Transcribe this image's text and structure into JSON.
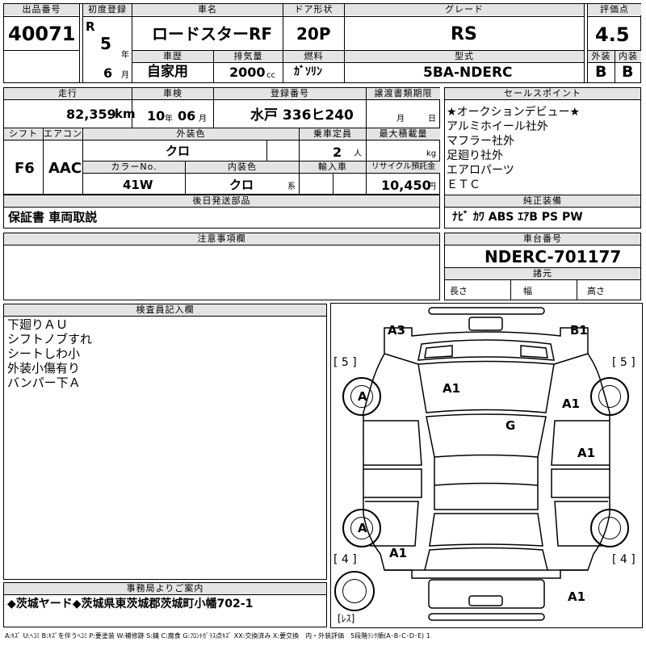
{
  "header": {
    "lot_no_label": "出品番号",
    "lot_no": "40071",
    "first_reg_label": "初度登録",
    "era": "R",
    "year": "5",
    "year_unit": "年",
    "month": "6",
    "month_unit": "月",
    "car_name_label": "車名",
    "car_name": "ロードスターRF",
    "door_label": "ドア形状",
    "door": "20P",
    "grade_label": "グレード",
    "grade": "RS",
    "score_label": "評価点",
    "score": "4.5",
    "history_label": "車歴",
    "history": "自家用",
    "displacement_label": "排気量",
    "displacement": "2000",
    "displacement_unit": "cc",
    "fuel_label": "燃料",
    "fuel": "ｶﾞｿﾘﾝ",
    "model_label": "型式",
    "model": "5BA-NDERC",
    "ext_label": "外装",
    "ext": "B",
    "int_label": "内装",
    "int": "B"
  },
  "row2": {
    "mileage_label": "走行",
    "mileage": "82,359",
    "mileage_unit": "km",
    "inspection_label": "車検",
    "insp_year": "10",
    "insp_year_unit": "年",
    "insp_month": "06",
    "insp_month_unit": "月",
    "reg_label": "登録番号",
    "reg": "水戸 336ヒ240",
    "transfer_label": "譲渡書類期限",
    "transfer_month_unit": "月",
    "transfer_day_unit": "日",
    "shift_label": "シフト",
    "shift": "F6",
    "ac_label": "エアコン",
    "ac": "AAC",
    "color_label": "外装色",
    "color": "クロ",
    "capacity_label": "乗車定員",
    "capacity": "2",
    "capacity_unit": "人",
    "load_label": "最大積載量",
    "load_unit": "kg",
    "color_no_label": "カラーNo.",
    "color_no": "41W",
    "interior_label": "内装色",
    "interior": "クロ",
    "interior_unit": "系",
    "import_label": "輸入車",
    "recycle_label": "リサイクル預託金",
    "recycle": "10,450",
    "recycle_unit": "円"
  },
  "later_parts": {
    "label": "後日発送部品",
    "text": "保証書 車両取説"
  },
  "sales_points": {
    "label": "セールスポイント",
    "items": [
      "★オークションデビュー★",
      "アルミホイール社外",
      "マフラー社外",
      "足廻り社外",
      "エアロパーツ",
      "ＥＴＣ"
    ]
  },
  "equipment": {
    "label": "純正装備",
    "text": "ﾅﾋﾞ ｶﾜ ABS ｴｱB PS PW"
  },
  "notes": {
    "label": "注意事項欄"
  },
  "chassis": {
    "label": "車台番号",
    "value": "NDERC-701177"
  },
  "specs": {
    "label": "諸元",
    "length": "長さ",
    "width": "幅",
    "height": "高さ"
  },
  "inspector": {
    "label": "検査員記入欄",
    "items": [
      "下廻りＡＵ",
      "シフトノブすれ",
      "シートしわ小",
      "外装小傷有り",
      "バンパー下Ａ"
    ]
  },
  "office": {
    "label": "事務局よりご案内",
    "text": "◆茨城ヤード◆茨城県東茨城郡茨城町小幡702-1"
  },
  "diagram": {
    "marks": {
      "a3": "A3",
      "b1": "B1",
      "hood": "A1",
      "fender_r": "A1",
      "roof": "G",
      "door_r": "A1",
      "quarter_l": "A1",
      "rear": "A1",
      "wheel_fl": "A",
      "wheel_rl": "A"
    },
    "tires": {
      "fl": "[ 5 ]",
      "fr": "[ 5 ]",
      "rl": "[ 4 ]",
      "rr": "[ 4 ]",
      "spare": "[ﾚｽ]"
    }
  },
  "legend": "A:ｷｽﾞ U:ﾍｺﾐ B:ｷｽﾞを伴うﾍｺﾐ P:要塗装 W:補修跡 S:錆 C:腐食 G:ﾌﾛﾝﾄｶﾞﾗｽ点ｷｽﾞ XX:交換済み X:要交換　内・外装評価　5段階ﾗﾝｸ順(A･B･C･D･E) 1"
}
